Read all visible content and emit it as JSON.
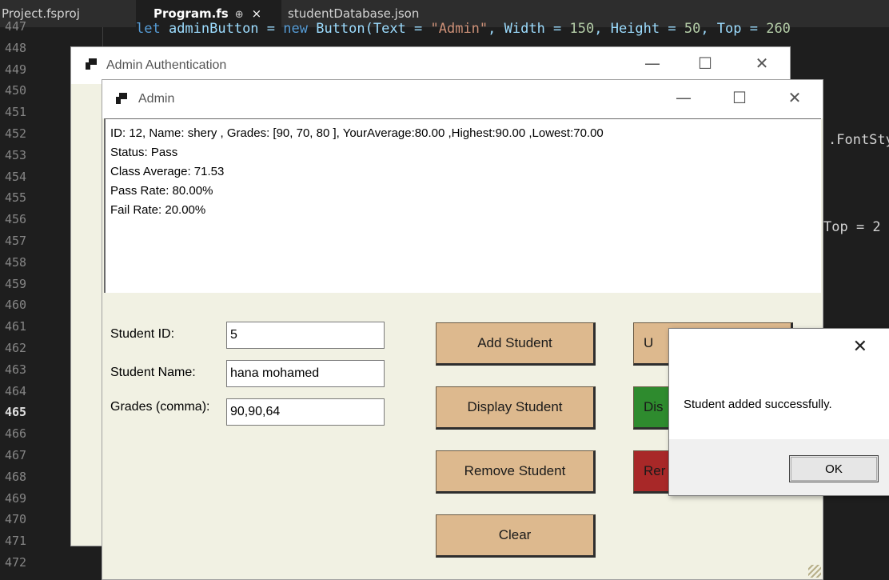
{
  "editor": {
    "tabs": [
      {
        "label": "Project.fsproj"
      },
      {
        "label": "Program.fs",
        "pin": "⊕",
        "close": "×"
      },
      {
        "label": "studentDatabase.json"
      }
    ],
    "line_numbers": [
      "447",
      "448",
      "449",
      "450",
      "451",
      "452",
      "453",
      "454",
      "455",
      "456",
      "457",
      "458",
      "459",
      "460",
      "461",
      "462",
      "463",
      "464",
      "465",
      "466",
      "467",
      "468",
      "469",
      "470",
      "471",
      "472"
    ],
    "active_line": "465",
    "code_top": {
      "kw1": "let",
      "ident": " adminButton = ",
      "kw2": "new",
      "cls": " Button(Text = ",
      "str": "\"Admin\"",
      "rest": ", Width = ",
      "n1": "150",
      "rest2": ", Height = ",
      "n2": "50",
      "rest3": ", Top = ",
      "n3": "260"
    },
    "frag1": ".FontSty",
    "frag2": "Top = 2"
  },
  "back_window": {
    "title": "Admin Authentication",
    "minimize": "—",
    "maximize": "☐",
    "close": "✕"
  },
  "admin_window": {
    "title": "Admin",
    "minimize": "—",
    "maximize": "☐",
    "close": "✕",
    "output_lines": [
      "ID: 12, Name: shery , Grades: [90, 70, 80 ], YourAverage:80.00 ,Highest:90.00 ,Lowest:70.00",
      "Status: Pass",
      "Class Average: 71.53",
      "Pass Rate: 80.00%",
      "Fail Rate: 20.00%"
    ],
    "form": {
      "student_id_label": "Student ID:",
      "student_id_value": "5",
      "student_name_label": "Student Name:",
      "student_name_value": "hana mohamed",
      "grades_label": "Grades (comma):",
      "grades_value": "90,90,64"
    },
    "buttons": {
      "add": "Add Student",
      "display": "Display Student",
      "remove": "Remove Student",
      "clear": "Clear",
      "right1_partial": "U",
      "right2_partial": "Dis",
      "right3_partial": "Rer"
    },
    "colors": {
      "button": "#ddb98e",
      "green": "#2e8b2e",
      "red": "#a82828",
      "background": "#f1f1e3"
    }
  },
  "message_box": {
    "close": "✕",
    "message": "Student added successfully.",
    "ok_label": "OK"
  }
}
